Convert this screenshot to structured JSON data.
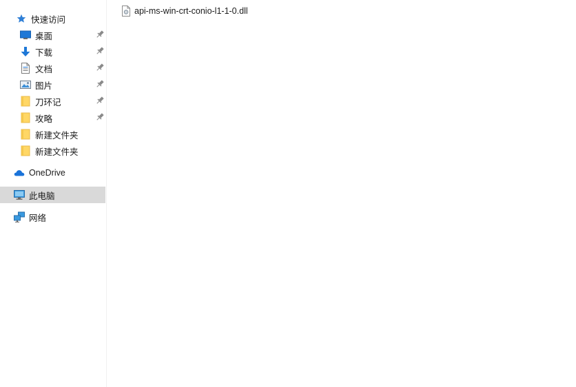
{
  "navigation": {
    "quick_access": {
      "label": "快速访问",
      "items": [
        {
          "label": "桌面",
          "icon": "desktop-icon",
          "pinned": true
        },
        {
          "label": "下载",
          "icon": "download-arrow-icon",
          "pinned": true
        },
        {
          "label": "文档",
          "icon": "document-icon",
          "pinned": true
        },
        {
          "label": "图片",
          "icon": "pictures-icon",
          "pinned": true
        },
        {
          "label": "刀环记",
          "icon": "folder-icon",
          "pinned": true
        },
        {
          "label": "攻略",
          "icon": "folder-icon",
          "pinned": true
        },
        {
          "label": "新建文件夹",
          "icon": "folder-icon",
          "pinned": false
        },
        {
          "label": "新建文件夹",
          "icon": "folder-icon",
          "pinned": false
        }
      ]
    },
    "onedrive": {
      "label": "OneDrive",
      "icon": "onedrive-cloud-icon"
    },
    "this_pc": {
      "label": "此电脑",
      "icon": "computer-icon",
      "selected": true
    },
    "network": {
      "label": "网络",
      "icon": "network-icon"
    }
  },
  "files": [
    {
      "name": "api-ms-win-crt-conio-l1-1-0.dll",
      "icon": "dll-file-icon"
    }
  ],
  "colors": {
    "selection": "#d9d9d9",
    "folder": "#ffd766",
    "folder_dark": "#e8b84a",
    "accent_blue": "#1e78d7",
    "pin": "#8a8a8a"
  }
}
